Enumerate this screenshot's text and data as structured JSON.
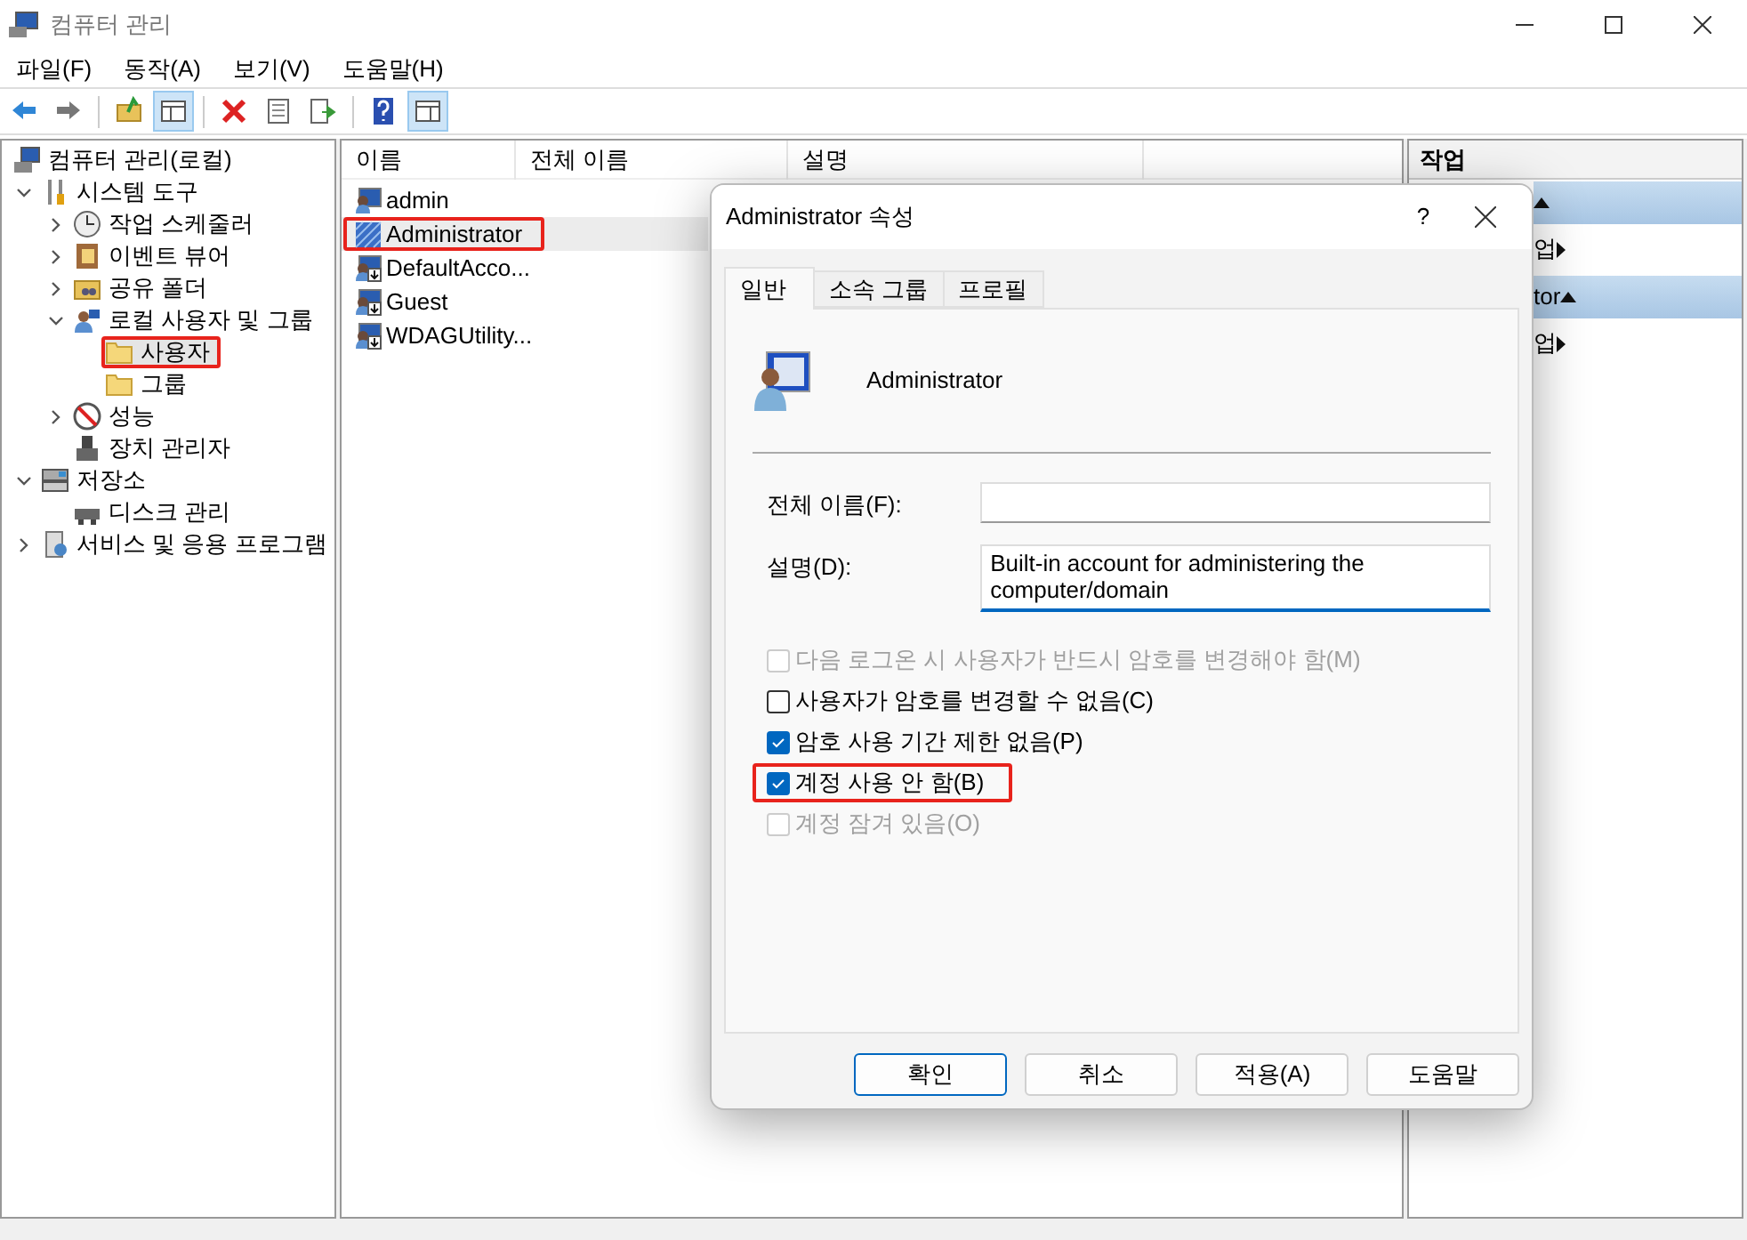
{
  "window": {
    "title": "컴퓨터 관리"
  },
  "menu": [
    "파일(F)",
    "동작(A)",
    "보기(V)",
    "도움말(H)"
  ],
  "toolbar": [
    [
      {
        "kind": "back",
        "pressed": false
      },
      {
        "kind": "forward",
        "pressed": false
      }
    ],
    [
      {
        "kind": "up",
        "pressed": false
      },
      {
        "kind": "tree",
        "pressed": true
      }
    ],
    [
      {
        "kind": "delete",
        "pressed": false
      },
      {
        "kind": "properties",
        "pressed": false
      },
      {
        "kind": "export",
        "pressed": false
      }
    ],
    [
      {
        "kind": "help",
        "pressed": false
      },
      {
        "kind": "actions",
        "pressed": true
      }
    ]
  ],
  "tree": [
    {
      "label": "컴퓨터 관리(로컬)",
      "kind": "computer",
      "selected": false,
      "annotated": false,
      "children": [
        {
          "label": "시스템 도구",
          "kind": "tools",
          "expanded": true,
          "selected": false,
          "annotated": false,
          "children": [
            {
              "label": "작업 스케줄러",
              "kind": "clock",
              "expanded": false,
              "selected": false,
              "annotated": false
            },
            {
              "label": "이벤트 뷰어",
              "kind": "event",
              "expanded": false,
              "selected": false,
              "annotated": false
            },
            {
              "label": "공유 폴더",
              "kind": "share",
              "expanded": false,
              "selected": false,
              "annotated": false
            },
            {
              "label": "로컬 사용자 및 그룹",
              "kind": "users",
              "expanded": true,
              "selected": false,
              "annotated": false,
              "children": [
                {
                  "label": "사용자",
                  "kind": "folder",
                  "selected": true,
                  "annotated": true
                },
                {
                  "label": "그룹",
                  "kind": "folder",
                  "selected": false,
                  "annotated": false
                }
              ]
            },
            {
              "label": "성능",
              "kind": "perf",
              "expanded": false,
              "selected": false,
              "annotated": false
            },
            {
              "label": "장치 관리자",
              "kind": "device",
              "selected": false,
              "annotated": false
            }
          ]
        },
        {
          "label": "저장소",
          "kind": "storage",
          "expanded": true,
          "selected": false,
          "annotated": false,
          "children": [
            {
              "label": "디스크 관리",
              "kind": "disk",
              "selected": false,
              "annotated": false
            }
          ]
        },
        {
          "label": "서비스 및 응용 프로그램",
          "kind": "services",
          "expanded": false,
          "selected": false,
          "annotated": false
        }
      ]
    }
  ],
  "list": {
    "columns": [
      "이름",
      "전체 이름",
      "설명"
    ],
    "rows": [
      {
        "name": "admin",
        "kind": "enabled",
        "selected": false,
        "annotated": false
      },
      {
        "name": "Administrator",
        "kind": "disabled",
        "selected": true,
        "annotated": true
      },
      {
        "name": "DefaultAcco...",
        "kind": "disabled",
        "selected": false,
        "annotated": false
      },
      {
        "name": "Guest",
        "kind": "disabled",
        "selected": false,
        "annotated": false
      },
      {
        "name": "WDAGUtility...",
        "kind": "disabled",
        "selected": false,
        "annotated": false
      }
    ]
  },
  "actions": {
    "title": "작업",
    "sections": [
      {
        "items": [
          "업"
        ]
      },
      {
        "title": "tor",
        "items": [
          "업"
        ]
      }
    ]
  },
  "dialog": {
    "title": "Administrator 속성",
    "help": "?",
    "tabs": [
      {
        "label": "일반",
        "selected": true
      },
      {
        "label": "소속 그룹",
        "selected": false
      },
      {
        "label": "프로필",
        "selected": false
      }
    ],
    "user": "Administrator",
    "fields": [
      {
        "label": "전체 이름(F):",
        "focused": false
      },
      {
        "label": "설명(D):",
        "value": "Built-in account for administering the computer/domain",
        "focused": true
      }
    ],
    "checkboxes": [
      {
        "label": "다음 로그온 시 사용자가 반드시 암호를 변경해야 함(M)",
        "checked": false,
        "disabled": true,
        "annotated": false
      },
      {
        "label": "사용자가 암호를 변경할 수 없음(C)",
        "checked": false,
        "disabled": false,
        "annotated": false
      },
      {
        "label": "암호 사용 기간 제한 없음(P)",
        "checked": true,
        "disabled": false,
        "annotated": false
      },
      {
        "label": "계정 사용 안 함(B)",
        "checked": true,
        "disabled": false,
        "annotated": true
      },
      {
        "label": "계정 잠겨 있음(O)",
        "checked": false,
        "disabled": true,
        "annotated": false
      }
    ],
    "buttons": [
      {
        "label": "확인",
        "default": true
      },
      {
        "label": "취소",
        "default": false
      },
      {
        "label": "적용(A)",
        "default": false
      },
      {
        "label": "도움말",
        "default": false
      }
    ]
  }
}
